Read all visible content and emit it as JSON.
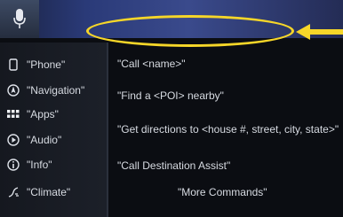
{
  "categories": [
    {
      "label": "\"Phone\"",
      "icon": "phone-icon"
    },
    {
      "label": "\"Navigation\"",
      "icon": "navigation-icon"
    },
    {
      "label": "\"Apps\"",
      "icon": "apps-grid-icon"
    },
    {
      "label": "\"Audio\"",
      "icon": "audio-play-icon"
    },
    {
      "label": "\"Info\"",
      "icon": "info-icon"
    },
    {
      "label": "\"Climate\"",
      "icon": "climate-icon"
    }
  ],
  "commands": [
    "\"Call <name>\"",
    "\"Find a <POI> nearby\"",
    "\"Get directions to <house #, street, city, state>\"",
    "\"Call Destination Assist\""
  ],
  "more_commands": "\"More Commands\"",
  "colors": {
    "highlight": "#f6d629"
  }
}
